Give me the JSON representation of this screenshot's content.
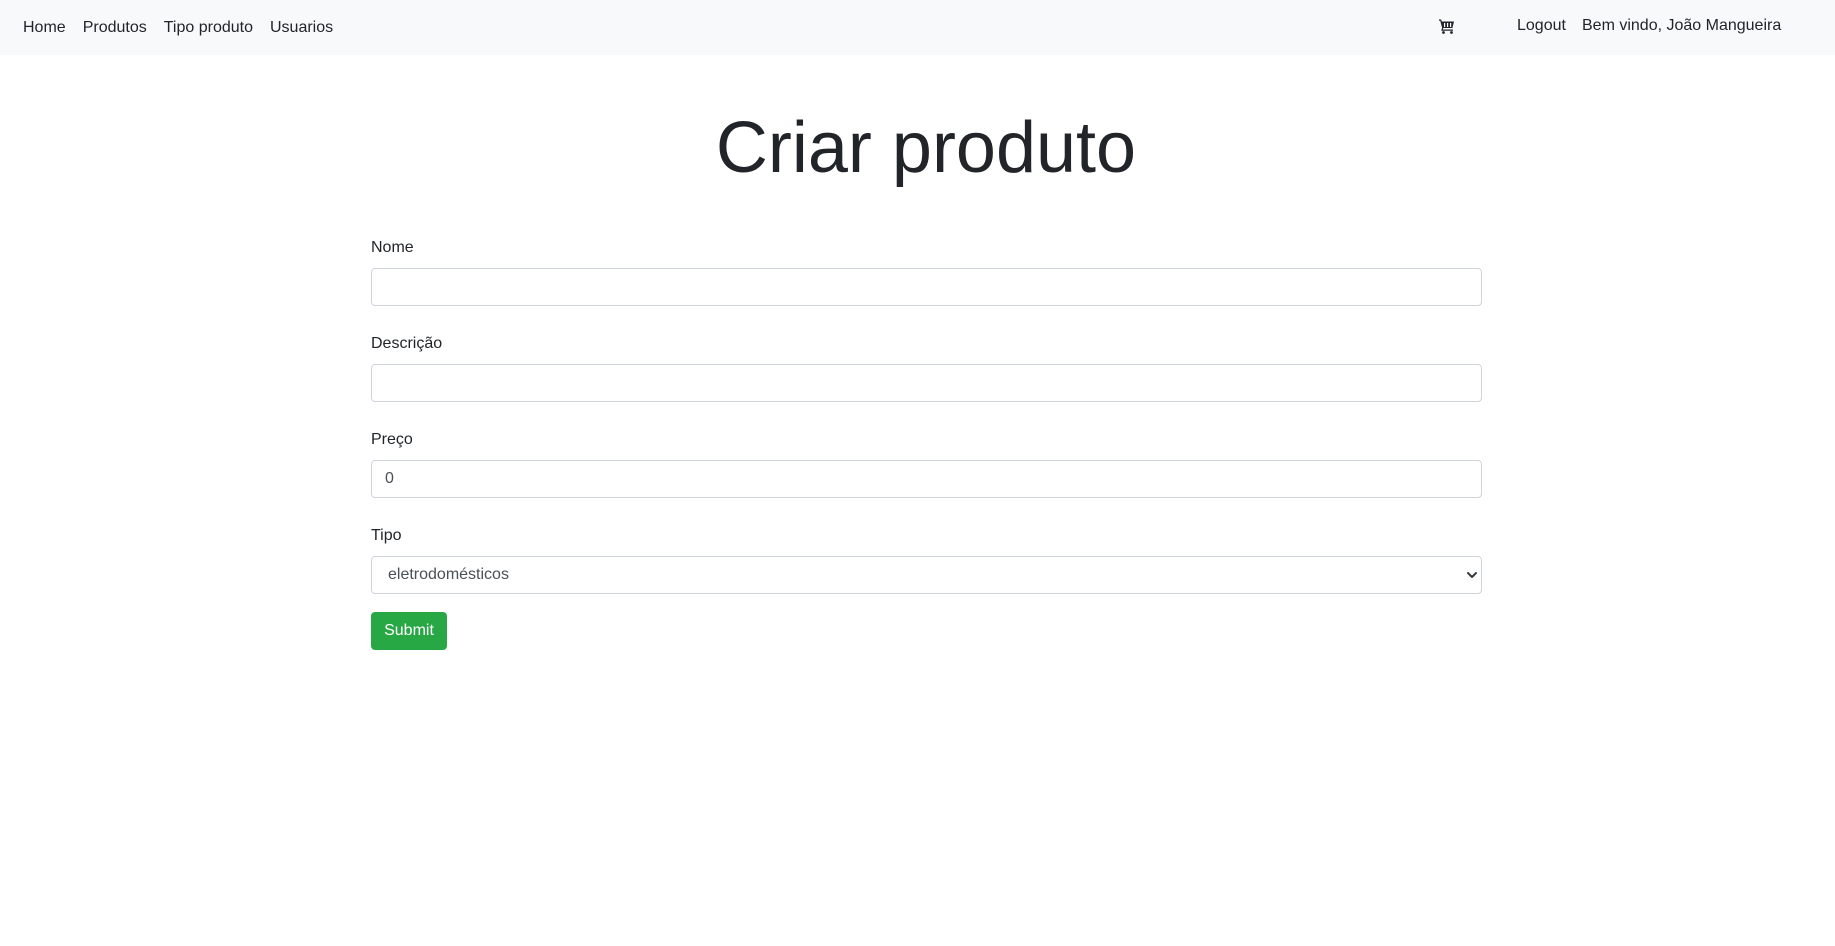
{
  "nav": {
    "links": [
      {
        "label": "Home"
      },
      {
        "label": "Produtos"
      },
      {
        "label": "Tipo produto"
      },
      {
        "label": "Usuarios"
      }
    ],
    "cart_icon": "shopping-cart-icon",
    "logout_label": "Logout",
    "welcome_text": "Bem vindo, João Mangueira"
  },
  "page": {
    "title": "Criar produto"
  },
  "form": {
    "nome": {
      "label": "Nome",
      "value": ""
    },
    "descricao": {
      "label": "Descrição",
      "value": ""
    },
    "preco": {
      "label": "Preço",
      "value": "0"
    },
    "tipo": {
      "label": "Tipo",
      "selected": "eletrodomésticos"
    },
    "submit_label": "Submit"
  },
  "colors": {
    "navbar_bg": "#f8f9fa",
    "submit_bg": "#28a745",
    "text": "#212529",
    "input_border": "#ced4da"
  }
}
